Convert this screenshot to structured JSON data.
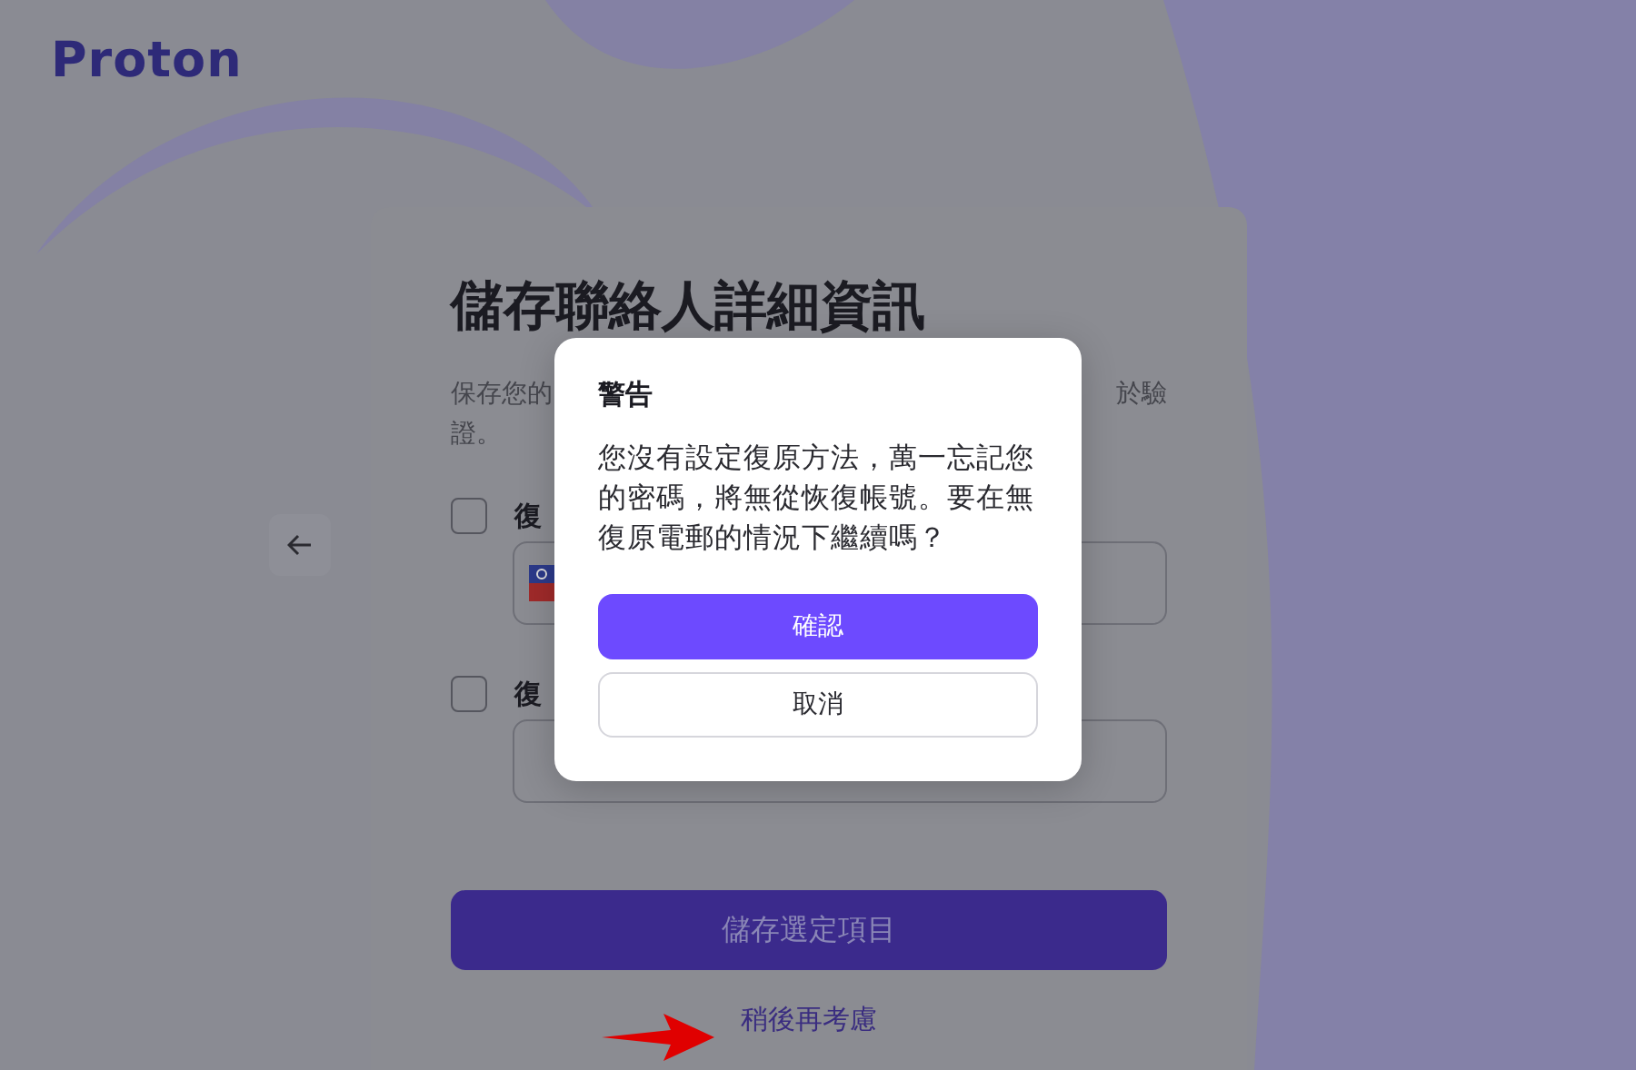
{
  "logo": {
    "text": "Proton"
  },
  "card": {
    "title": "儲存聯絡人詳細資訊",
    "description": {
      "left": "保存您的",
      "right": "於驗",
      "second_line": "證。"
    },
    "options": [
      {
        "kind": "phone",
        "label": "復",
        "checked": false
      },
      {
        "kind": "email",
        "label": "復",
        "checked": false
      }
    ],
    "save_button": "儲存選定項目",
    "later_link": "稍後再考慮"
  },
  "dialog": {
    "title": "警告",
    "message": "您沒有設定復原方法，萬一忘記您的密碼，將無從恢復帳號。要在無復原電郵的情況下繼續嗎？",
    "buttons": [
      {
        "label": "確認",
        "kind": "primary"
      },
      {
        "label": "取消",
        "kind": "secondary"
      }
    ]
  }
}
